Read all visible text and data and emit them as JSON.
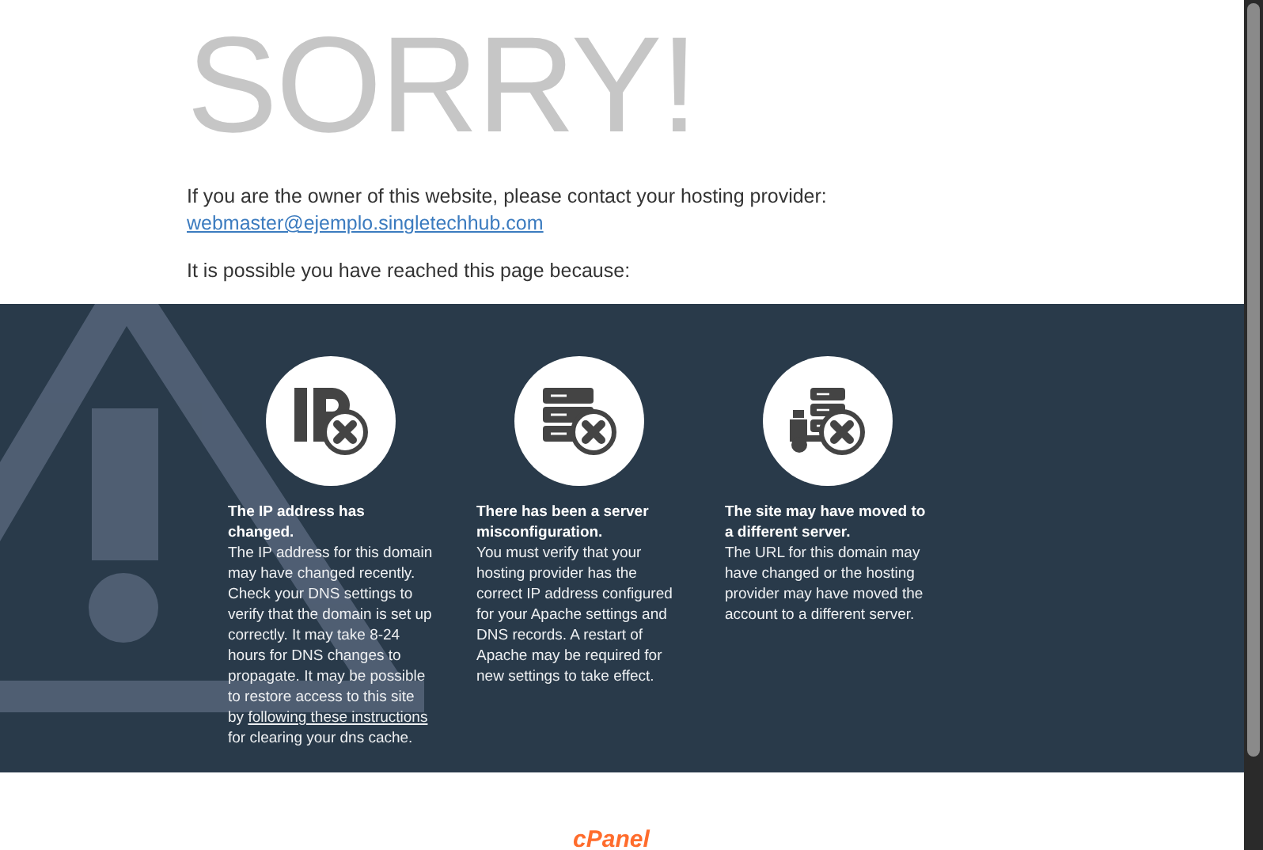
{
  "title": "SORRY!",
  "contact": {
    "text": "If you are the owner of this website, please contact your hosting provider:",
    "email": "webmaster@ejemplo.singletechhub.com"
  },
  "intro": "It is possible you have reached this page because:",
  "reasons": [
    {
      "kind": "ip",
      "heading": "The IP address has changed.",
      "text": "The IP address for this domain may have changed recently. Check your DNS settings to verify that the domain is set up correctly. It may take 8-24 hours for DNS changes to propagate. It may be possible to restore access to this site by",
      "link": "following these instructions",
      "text_after": "for clearing your dns cache."
    },
    {
      "kind": "server",
      "heading": "There has been a server misconfiguration.",
      "text": "You must verify that your hosting provider has the correct IP address configured for your Apache settings and DNS records. A restart of Apache may be required for new settings to take effect."
    },
    {
      "kind": "moved",
      "heading": "The site may have moved to a different server.",
      "text": "The URL for this domain may have changed or the hosting provider may have moved the account to a different server."
    }
  ],
  "footer": {
    "logo": "cPanel"
  }
}
